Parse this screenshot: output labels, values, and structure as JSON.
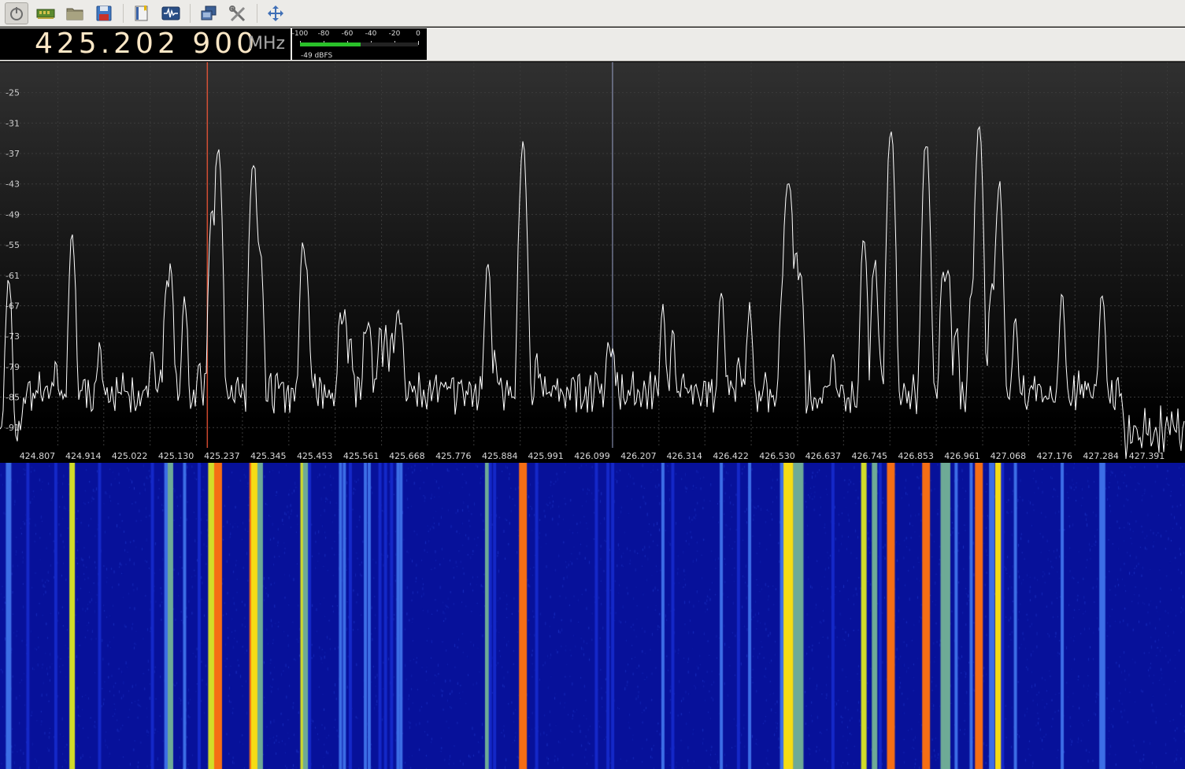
{
  "toolbar": {
    "buttons": [
      {
        "name": "power-button",
        "icon": "power-icon"
      },
      {
        "name": "device-button",
        "icon": "device-card-icon"
      },
      {
        "name": "open-button",
        "icon": "folder-icon"
      },
      {
        "name": "save-button",
        "icon": "floppy-icon"
      },
      {
        "name": "bookmarks-button",
        "icon": "bookmark-icon"
      },
      {
        "name": "waveform-button",
        "icon": "waveform-icon"
      },
      {
        "name": "remote-button",
        "icon": "remote-icon"
      },
      {
        "name": "tools-button",
        "icon": "tools-icon"
      },
      {
        "name": "fullscreen-button",
        "icon": "move-arrows-icon"
      }
    ]
  },
  "frequency": {
    "value": "425.202 900",
    "unit": "MHz"
  },
  "signal_meter": {
    "scale_labels": [
      "-100",
      "-80",
      "-60",
      "-40",
      "-20",
      "0"
    ],
    "level_dbfs": -49,
    "level_label": "-49 dBFS",
    "bar_color": "#2ac12a"
  },
  "colors": {
    "trace": "#ffffff",
    "demod_marker": "#ff5a3a",
    "center_marker": "#9aa3c8",
    "waterfall_bg": "#07119a"
  },
  "chart_data": {
    "type": "line",
    "title": "",
    "xlabel": "",
    "ylabel": "",
    "x_unit": "MHz",
    "xlim": [
      424.72,
      427.48
    ],
    "ylim": [
      -95,
      -19
    ],
    "y_ticks": [
      "-25",
      "-31",
      "-37",
      "-43",
      "-49",
      "-55",
      "-61",
      "-67",
      "-73",
      "-79",
      "-85",
      "-91"
    ],
    "x_ticks": [
      "424.807",
      "424.914",
      "425.022",
      "425.130",
      "425.237",
      "425.345",
      "425.453",
      "425.561",
      "425.668",
      "425.776",
      "425.884",
      "425.991",
      "426.099",
      "426.207",
      "426.314",
      "426.422",
      "426.530",
      "426.637",
      "426.745",
      "426.853",
      "426.961",
      "427.068",
      "427.176",
      "427.284",
      "427.391"
    ],
    "demod_frequency": 425.2029,
    "center_frequency": 426.099,
    "noise_floor": -84,
    "series": [
      {
        "x": [
          424.74,
          424.785,
          424.85,
          424.888,
          424.952,
          425.075,
          425.109,
          425.117,
          425.15,
          425.184,
          425.214,
          425.228,
          425.31,
          425.314,
          425.326,
          425.426,
          425.432,
          425.441,
          425.513,
          425.522,
          425.536,
          425.571,
          425.58,
          425.605,
          425.618,
          425.632,
          425.647,
          425.654,
          425.856,
          425.862,
          425.872,
          425.938,
          425.97,
          426.109,
          426.136,
          426.147,
          426.264,
          426.287,
          426.4,
          426.44,
          426.466,
          426.543,
          426.554,
          426.559,
          426.574,
          426.585,
          426.66,
          426.732,
          426.757,
          426.77,
          426.795,
          426.877,
          426.917,
          426.927,
          426.947,
          426.982,
          427.0,
          427.03,
          427.047,
          427.055,
          427.085,
          427.194,
          427.284,
          427.288
        ],
        "values": [
          -62,
          -82,
          -79,
          -54,
          -74,
          -76,
          -62,
          -60,
          -66,
          -77,
          -49,
          -36,
          -38,
          -45,
          -56,
          -54,
          -58,
          -76,
          -68,
          -68,
          -73,
          -71,
          -70,
          -72,
          -72,
          -73,
          -67,
          -69,
          -59,
          -74,
          -77,
          -35,
          -77,
          -79,
          -74,
          -76,
          -68,
          -72,
          -65,
          -76,
          -67,
          -62,
          -42,
          -44,
          -56,
          -61,
          -77,
          -54,
          -58,
          -77,
          -33,
          -35,
          -59,
          -59,
          -71,
          -65,
          -32,
          -62,
          -43,
          -72,
          -69,
          -65,
          -69,
          -64
        ]
      }
    ]
  }
}
